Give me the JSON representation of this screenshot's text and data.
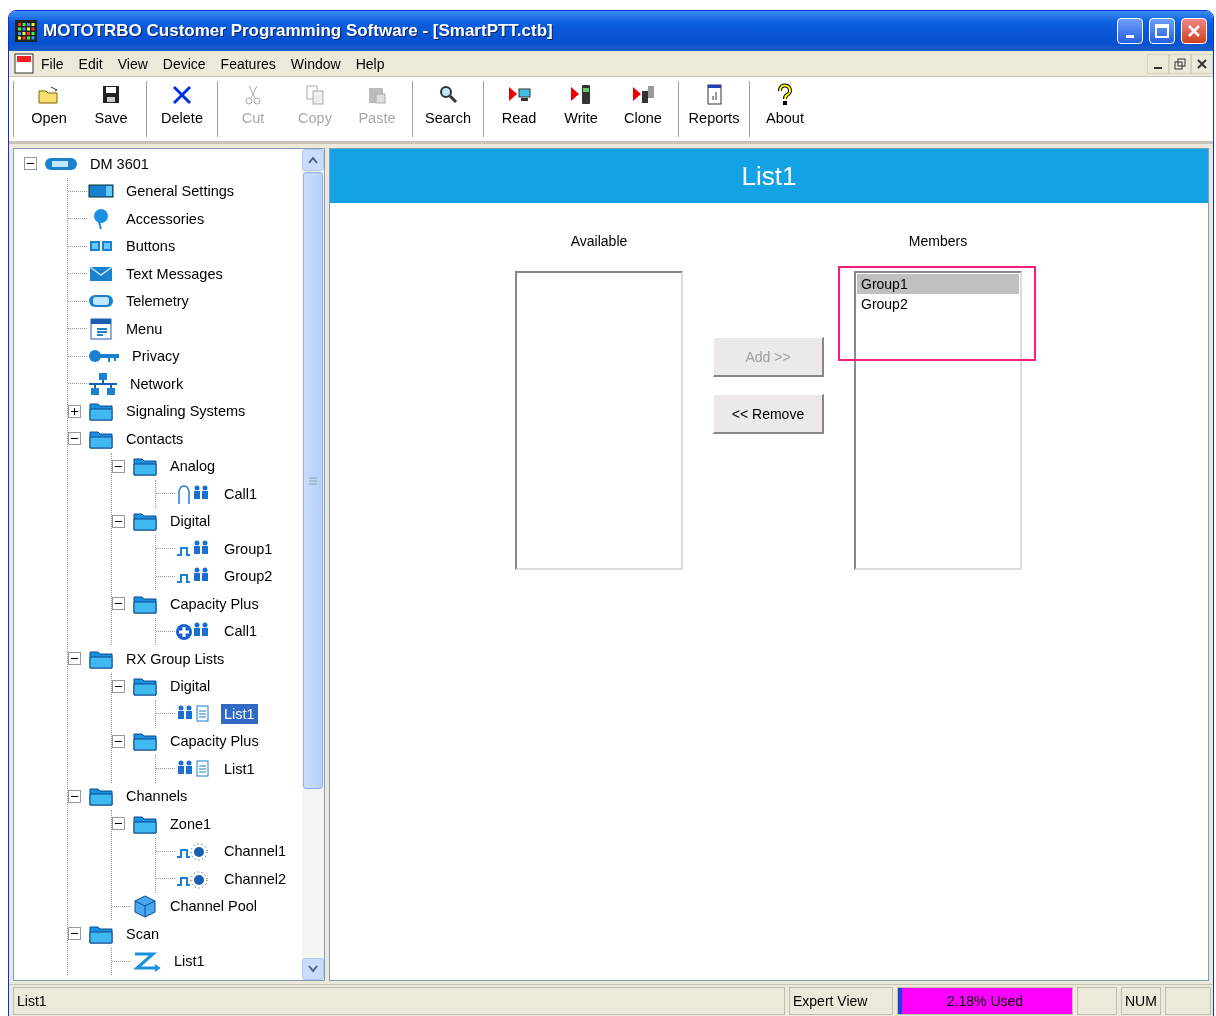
{
  "window": {
    "title": "MOTOTRBO Customer Programming Software - [SmartPTT.ctb]"
  },
  "menu": [
    "File",
    "Edit",
    "View",
    "Device",
    "Features",
    "Window",
    "Help"
  ],
  "toolbar": [
    [
      {
        "label": "Open",
        "disabled": false
      },
      {
        "label": "Save",
        "disabled": false
      }
    ],
    [
      {
        "label": "Delete",
        "disabled": false
      }
    ],
    [
      {
        "label": "Cut",
        "disabled": true
      },
      {
        "label": "Copy",
        "disabled": true
      },
      {
        "label": "Paste",
        "disabled": true
      }
    ],
    [
      {
        "label": "Search",
        "disabled": false
      }
    ],
    [
      {
        "label": "Read",
        "disabled": false
      },
      {
        "label": "Write",
        "disabled": false
      },
      {
        "label": "Clone",
        "disabled": false
      }
    ],
    [
      {
        "label": "Reports",
        "disabled": false
      }
    ],
    [
      {
        "label": "About",
        "disabled": false
      }
    ]
  ],
  "tree": [
    {
      "label": "DM 3601",
      "kind": "radio",
      "expanded": true,
      "selected": false,
      "children": [
        {
          "label": "General Settings",
          "kind": "settings",
          "selected": false
        },
        {
          "label": "Accessories",
          "kind": "accessory",
          "selected": false
        },
        {
          "label": "Buttons",
          "kind": "buttons",
          "selected": false
        },
        {
          "label": "Text Messages",
          "kind": "mail",
          "selected": false
        },
        {
          "label": "Telemetry",
          "kind": "telemetry",
          "selected": false
        },
        {
          "label": "Menu",
          "kind": "menu",
          "selected": false
        },
        {
          "label": "Privacy",
          "kind": "key",
          "selected": false
        },
        {
          "label": "Network",
          "kind": "network",
          "selected": false
        },
        {
          "label": "Signaling Systems",
          "kind": "folder",
          "expanded": false,
          "selected": false
        },
        {
          "label": "Contacts",
          "kind": "folder",
          "expanded": true,
          "selected": false,
          "children": [
            {
              "label": "Analog",
              "kind": "folder",
              "expanded": true,
              "selected": false,
              "children": [
                {
                  "label": "Call1",
                  "kind": "analog",
                  "selected": false
                }
              ]
            },
            {
              "label": "Digital",
              "kind": "folder",
              "expanded": true,
              "selected": false,
              "children": [
                {
                  "label": "Group1",
                  "kind": "digital",
                  "selected": false
                },
                {
                  "label": "Group2",
                  "kind": "digital",
                  "selected": false
                }
              ]
            },
            {
              "label": "Capacity Plus",
              "kind": "folder",
              "expanded": true,
              "selected": false,
              "children": [
                {
                  "label": "Call1",
                  "kind": "capacity",
                  "selected": false
                }
              ]
            }
          ]
        },
        {
          "label": "RX Group Lists",
          "kind": "folder",
          "expanded": true,
          "selected": false,
          "children": [
            {
              "label": "Digital",
              "kind": "folder",
              "expanded": true,
              "selected": false,
              "children": [
                {
                  "label": "List1",
                  "kind": "grouplist",
                  "selected": true
                }
              ]
            },
            {
              "label": "Capacity Plus",
              "kind": "folder",
              "expanded": true,
              "selected": false,
              "children": [
                {
                  "label": "List1",
                  "kind": "grouplist",
                  "selected": false
                }
              ]
            }
          ]
        },
        {
          "label": "Channels",
          "kind": "folder",
          "expanded": true,
          "selected": false,
          "children": [
            {
              "label": "Zone1",
              "kind": "folder",
              "expanded": true,
              "selected": false,
              "children": [
                {
                  "label": "Channel1",
                  "kind": "channel",
                  "selected": false
                },
                {
                  "label": "Channel2",
                  "kind": "channel",
                  "selected": false
                }
              ]
            },
            {
              "label": "Channel Pool",
              "kind": "pool",
              "selected": false
            }
          ]
        },
        {
          "label": "Scan",
          "kind": "folder",
          "expanded": true,
          "selected": false,
          "children": [
            {
              "label": "List1",
              "kind": "scan",
              "selected": false
            }
          ]
        }
      ]
    }
  ],
  "panel": {
    "title": "List1",
    "available": {
      "label": "Available"
    },
    "buttons": [
      {
        "label": "Add >>",
        "disabled": true
      },
      {
        "label": "<< Remove",
        "disabled": false
      }
    ],
    "members": {
      "label": "Members",
      "items": [
        {
          "label": "Group1",
          "selected": true
        },
        {
          "label": "Group2",
          "selected": false
        }
      ],
      "highlighted": true
    }
  },
  "status_bar": {
    "text": "List1",
    "view": "Expert View",
    "usage": {
      "label": "2.18% Used",
      "level": 0.0218
    },
    "num": "NUM"
  }
}
